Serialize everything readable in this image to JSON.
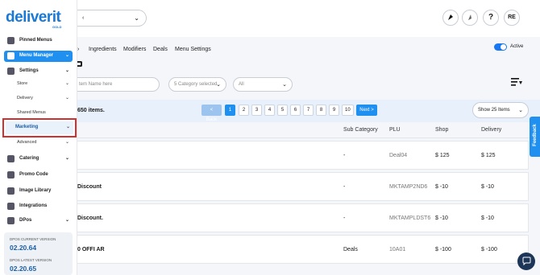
{
  "sidebar": {
    "logo": "deliverit",
    "logo_sub": "GOLD",
    "items": [
      {
        "label": "Pinned Menus"
      },
      {
        "label": "Menu Manager"
      },
      {
        "label": "Settings"
      },
      {
        "label": "Store"
      },
      {
        "label": "Delivery"
      },
      {
        "label": "Shared Menus"
      },
      {
        "label": "Marketing"
      },
      {
        "label": "Advanced"
      },
      {
        "label": "Catering"
      },
      {
        "label": "Promo Code"
      },
      {
        "label": "Image Library"
      },
      {
        "label": "Integrations"
      },
      {
        "label": "DPos"
      }
    ],
    "versions": {
      "current_label": "DPOS CURRENT VERSION",
      "current_value": "02.20.64",
      "latest_label": "DPOS LATEST VERSION",
      "latest_value": "02.20.65"
    }
  },
  "header": {
    "avatar": "RE",
    "help": "?"
  },
  "tabs": [
    "Ingredients",
    "Modifiers",
    "Deals",
    "Menu Settings"
  ],
  "active_toggle_label": "Active",
  "filters": {
    "search_placeholder": "tem Name here",
    "category_placeholder": "5 Category selected",
    "all_label": "All"
  },
  "pagination": {
    "count_text": "650 items.",
    "back_label": "< Back",
    "pages": [
      "1",
      "2",
      "3",
      "4",
      "5",
      "6",
      "7",
      "8",
      "9",
      "10"
    ],
    "current_page": "1",
    "next_label": "Next >",
    "show_label": "Show 25 Items"
  },
  "table": {
    "headers": [
      "Sub Category",
      "PLU",
      "Shop",
      "Delivery"
    ],
    "rows": [
      {
        "name": "",
        "sub_category": "-",
        "plu": "Deal04",
        "shop": "$ 125",
        "delivery": "$ 125"
      },
      {
        "name": "Discount",
        "sub_category": "-",
        "plu": "MKTAMP2ND6",
        "shop": "$ -10",
        "delivery": "$ -10"
      },
      {
        "name": "Discount.",
        "sub_category": "-",
        "plu": "MKTAMPLDST6",
        "shop": "$ -10",
        "delivery": "$ -10"
      },
      {
        "name": "0 OFFI AR",
        "sub_category": "Deals",
        "plu": "10A01",
        "shop": "$ -100",
        "delivery": "$ -100"
      }
    ]
  },
  "feedback_label": "Feedback",
  "colors": {
    "accent": "#1f8ff0",
    "highlight": "#d32f2f",
    "brand": "#1a79d6"
  }
}
